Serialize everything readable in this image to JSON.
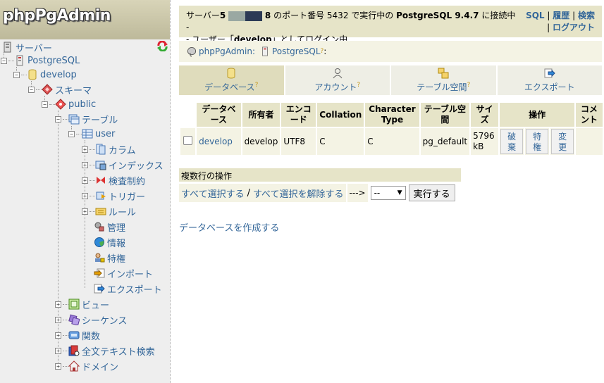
{
  "logo": {
    "text": "phpPgAdmin"
  },
  "tree": {
    "server": "サーバー",
    "postgresql": "PostgreSQL",
    "database": "develop",
    "schema": "スキーマ",
    "public": "public",
    "tables": "テーブル",
    "table_user": "user",
    "columns": "カラム",
    "indexes": "インデックス",
    "constraints": "検査制約",
    "triggers": "トリガー",
    "rules": "ルール",
    "admin": "管理",
    "info": "情報",
    "privileges": "特権",
    "import": "インポート",
    "export": "エクスポート",
    "views": "ビュー",
    "sequences": "シーケンス",
    "functions": "関数",
    "fulltext": "全文テキスト検索",
    "domains": "ドメイン"
  },
  "topbar": {
    "server_prefix": "サーバー",
    "server_name_start": "5",
    "server_name_end": "8",
    "port_text": "のポート番号 5432 で実行中の",
    "version": "PostgreSQL 9.4.7",
    "connected": "に接続中 -",
    "user_prefix": "- ユーザー「",
    "user": "develop",
    "user_suffix": "」としてログイン中",
    "link_sql": "SQL",
    "link_history": "履歴",
    "link_search": "検索",
    "link_logout": "ログアウト",
    "sep": "|"
  },
  "breadcrumb": {
    "app": "phpPgAdmin:",
    "server": "PostgreSQL",
    "help": "?",
    "suffix": ":"
  },
  "tabs": [
    {
      "label": "データベース",
      "help": "?"
    },
    {
      "label": "アカウント",
      "help": "?"
    },
    {
      "label": "テーブル空間",
      "help": "?"
    },
    {
      "label": "エクスポート"
    }
  ],
  "table": {
    "headers": {
      "database": "データベース",
      "owner": "所有者",
      "encoding": "エンコード",
      "collation": "Collation",
      "ctype": "Character Type",
      "tablespace": "テーブル空間",
      "size": "サイズ",
      "actions": "操作",
      "comment": "コメント"
    },
    "row": {
      "database": "develop",
      "owner": "develop",
      "encoding": "UTF8",
      "collation": "C",
      "ctype": "C",
      "tablespace": "pg_default",
      "size": "5796 kB",
      "btn_drop": "破棄",
      "btn_privileges": "特権",
      "btn_alter": "変更",
      "comment": ""
    }
  },
  "multi": {
    "title": "複数行の操作",
    "select_all": "すべて選択する",
    "slash": "/",
    "deselect_all": "すべて選択を解除する",
    "arrow": "--->",
    "select_value": "--",
    "execute": "実行する"
  },
  "create_db": "データベースを作成する"
}
